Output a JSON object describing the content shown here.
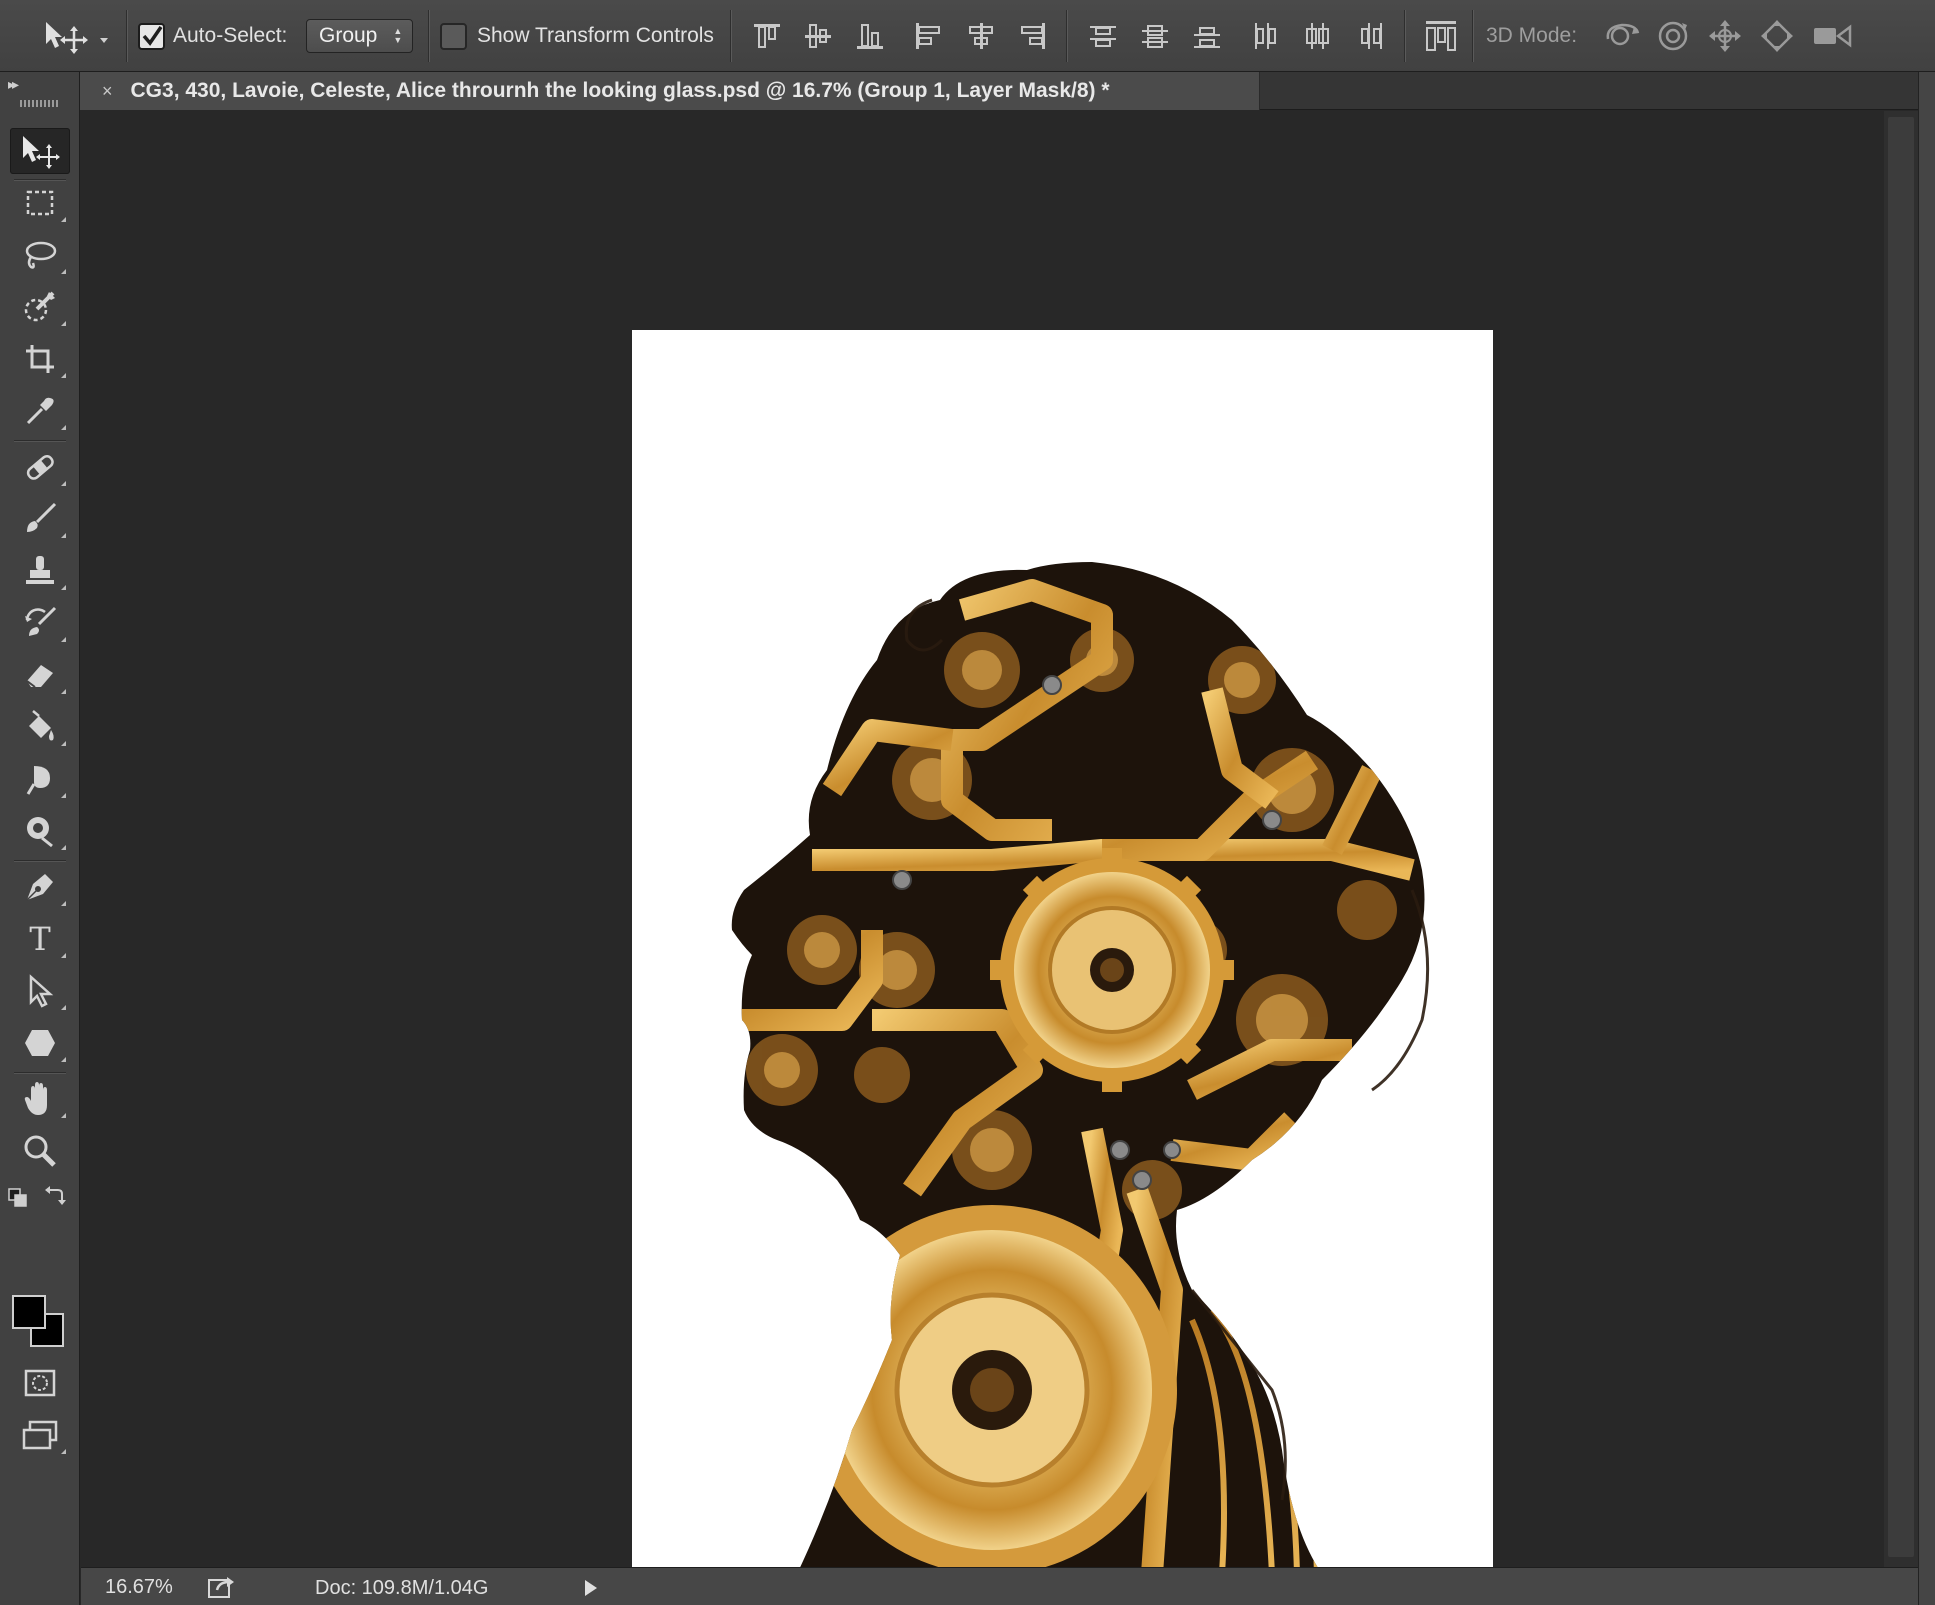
{
  "options_bar": {
    "tool_preset_icon": "move-tool-icon",
    "auto_select": {
      "label": "Auto-Select:",
      "checked": true
    },
    "auto_select_target": {
      "value": "Group"
    },
    "show_transform_controls": {
      "label": "Show Transform Controls",
      "checked": false
    },
    "align_icons": [
      "align-top-edges-icon",
      "align-vertical-centers-icon",
      "align-bottom-edges-icon",
      "align-left-edges-icon",
      "align-horizontal-centers-icon",
      "align-right-edges-icon"
    ],
    "distribute_icons": [
      "distribute-top-edges-icon",
      "distribute-vertical-centers-icon",
      "distribute-bottom-edges-icon",
      "distribute-left-edges-icon",
      "distribute-horizontal-centers-icon",
      "distribute-right-edges-icon"
    ],
    "auto_align_icon": "auto-align-layers-icon",
    "mode_3d": {
      "label": "3D Mode:",
      "icons": [
        "rotate-3d-icon",
        "roll-3d-icon",
        "drag-3d-icon",
        "slide-3d-icon",
        "scale-3d-icon"
      ]
    }
  },
  "document_tab": {
    "close_glyph": "×",
    "title": "CG3, 430, Lavoie, Celeste, Alice thrournh the looking glass.psd @ 16.7% (Group 1, Layer Mask/8) *"
  },
  "toolbox": {
    "collapse_glyph": "▸▸",
    "tools": [
      {
        "name": "move-tool-icon",
        "active": true
      },
      {
        "name": "rectangular-marquee-tool-icon"
      },
      {
        "name": "lasso-tool-icon"
      },
      {
        "name": "quick-selection-tool-icon"
      },
      {
        "name": "crop-tool-icon"
      },
      {
        "name": "eyedropper-tool-icon"
      },
      {
        "name": "spot-healing-brush-tool-icon"
      },
      {
        "name": "brush-tool-icon"
      },
      {
        "name": "clone-stamp-tool-icon"
      },
      {
        "name": "history-brush-tool-icon"
      },
      {
        "name": "eraser-tool-icon"
      },
      {
        "name": "paint-bucket-tool-icon"
      },
      {
        "name": "blur-tool-icon"
      },
      {
        "name": "dodge-tool-icon"
      },
      {
        "name": "pen-tool-icon"
      },
      {
        "name": "type-tool-icon"
      },
      {
        "name": "path-selection-tool-icon"
      },
      {
        "name": "shape-tool-icon"
      },
      {
        "name": "hand-tool-icon"
      },
      {
        "name": "zoom-tool-icon"
      }
    ],
    "type_tool_glyph": "T",
    "foreground_color": "#000000",
    "background_color": "#000000"
  },
  "colors": {
    "ui_panel": "#414141",
    "canvas_background": "#282828",
    "document_background": "#ffffff",
    "gold": "#d9a441",
    "dark_gear_gap": "#1c120a"
  },
  "status_bar": {
    "zoom": "16.67%",
    "doc_size": "Doc: 109.8M/1.04G"
  }
}
